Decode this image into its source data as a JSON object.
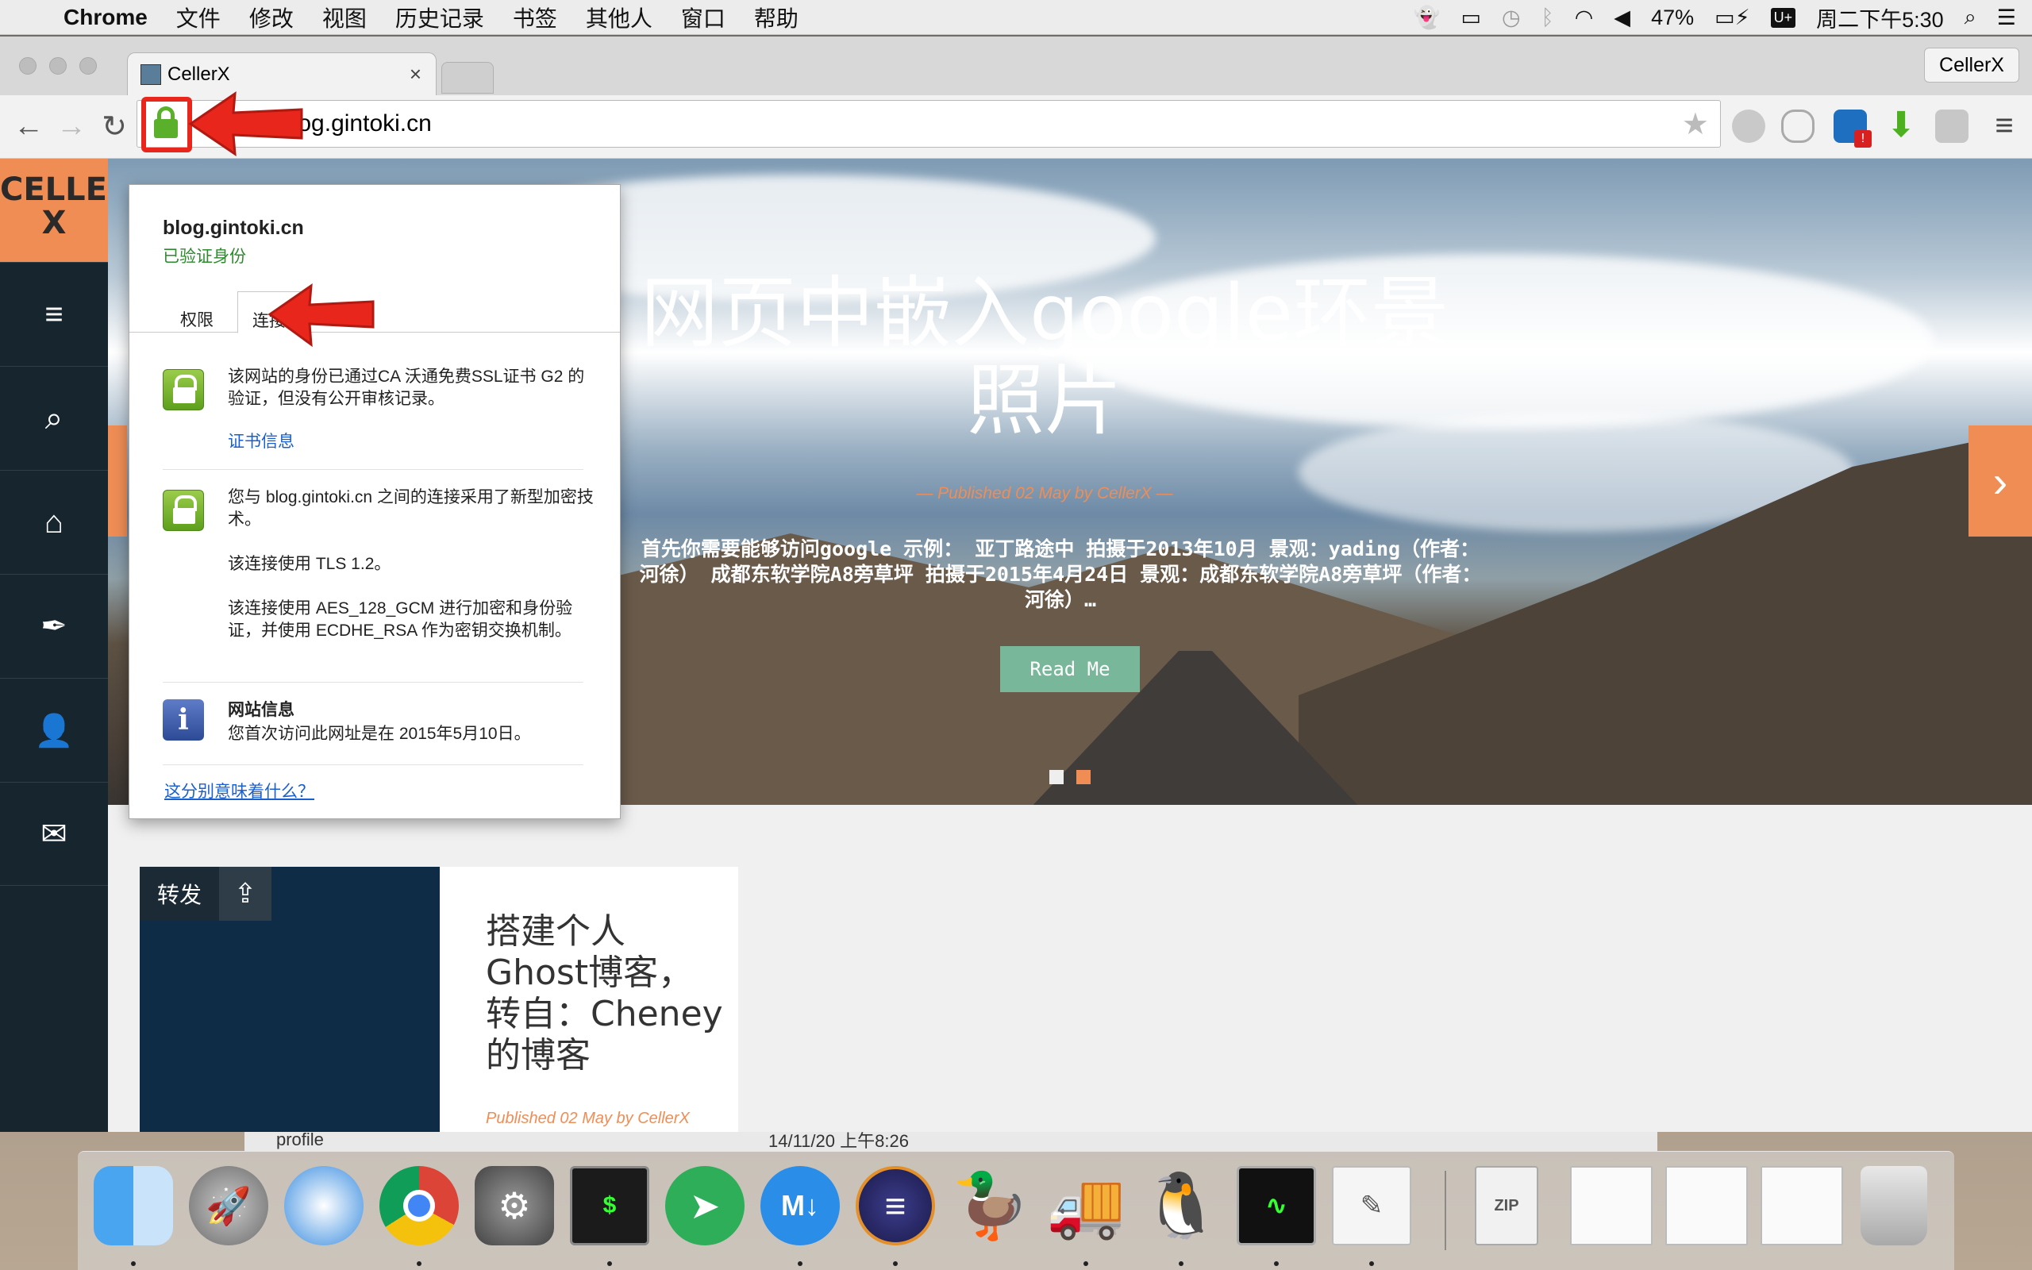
{
  "menubar": {
    "app_name": "Chrome",
    "items": [
      "文件",
      "修改",
      "视图",
      "历史记录",
      "书签",
      "其他人",
      "窗口",
      "帮助"
    ],
    "battery": "47%",
    "input_method": "U+",
    "clock": "周二下午5:30"
  },
  "browser": {
    "tab_title": "CellerX",
    "profile_name": "CellerX",
    "url": "blog.gintoki.cn",
    "url_prefix": "://"
  },
  "site": {
    "logo_top": "CELLER",
    "logo_bottom": "X",
    "hero": {
      "title": "网页中嵌入google环景照片",
      "meta": "— Published 02 May by CellerX —",
      "excerpt": "首先你需要能够访问google 示例： 亚丁路途中 拍摄于2013年10月 景观：yading（作者：河徐） 成都东软学院A8旁草坪 拍摄于2015年4月24日 景观：成都东软学院A8旁草坪（作者：河徐）…",
      "button": "Read Me"
    },
    "card": {
      "share_label": "转发",
      "title": "搭建个人Ghost博客，转自：Cheney的博客",
      "meta": "Published 02 May by CellerX"
    }
  },
  "security_popup": {
    "domain": "blog.gintoki.cn",
    "verified": "已验证身份",
    "tabs": [
      "权限",
      "连接"
    ],
    "identity_text": "该网站的身份已通过CA 沃通免费SSL证书 G2 的验证，但没有公开审核记录。",
    "cert_link": "证书信息",
    "connection_text": "您与 blog.gintoki.cn 之间的连接采用了新型加密技术。",
    "tls_text": "该连接使用 TLS 1.2。",
    "cipher_text": "该连接使用 AES_128_GCM 进行加密和身份验证，并使用 ECDHE_RSA 作为密钥交换机制。",
    "site_info_title": "网站信息",
    "site_info_text": "您首次访问此网址是在 2015年5月10日。",
    "help_link": "这分别意味着什么？"
  },
  "background_window": {
    "row_label": "profile",
    "row_date": "14/11/20 上午8:26"
  },
  "colors": {
    "accent": "#f08d55",
    "sidebar": "#17252f",
    "readme": "#79b79a",
    "annotation_red": "#e8261b"
  },
  "icons": [
    "apple-icon",
    "back-icon",
    "forward-icon",
    "reload-icon",
    "lock-icon",
    "star-icon",
    "menu-icon",
    "search-icon",
    "home-icon",
    "pen-icon",
    "user-icon",
    "mail-icon",
    "share-icon",
    "info-icon"
  ]
}
